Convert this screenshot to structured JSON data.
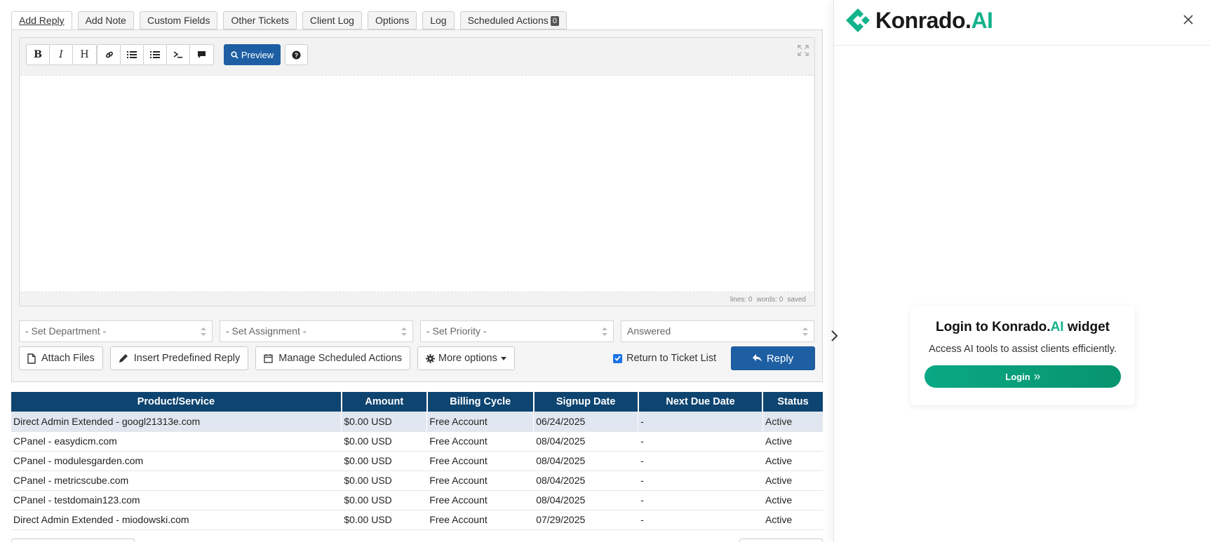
{
  "tabs": [
    {
      "label": "Add Reply",
      "active": true
    },
    {
      "label": "Add Note"
    },
    {
      "label": "Custom Fields"
    },
    {
      "label": "Other Tickets"
    },
    {
      "label": "Client Log"
    },
    {
      "label": "Options"
    },
    {
      "label": "Log"
    },
    {
      "label": "Scheduled Actions",
      "badge": "0"
    }
  ],
  "editor": {
    "toolbar": {
      "bold": "B",
      "italic": "I",
      "heading": "H",
      "preview_label": "Preview"
    },
    "status": {
      "lines": "lines: 0",
      "words": "words: 0",
      "saved": "saved"
    }
  },
  "selects": {
    "department": "- Set Department -",
    "assignment": "- Set Assignment -",
    "priority": "- Set Priority -",
    "status": "Answered"
  },
  "actions": {
    "attach": "Attach Files",
    "predefined": "Insert Predefined Reply",
    "scheduled": "Manage Scheduled Actions",
    "more": "More options",
    "return_label": "Return to Ticket List",
    "return_checked": true,
    "reply": "Reply"
  },
  "table": {
    "headers": [
      "Product/Service",
      "Amount",
      "Billing Cycle",
      "Signup Date",
      "Next Due Date",
      "Status"
    ],
    "rows": [
      [
        "Direct Admin Extended - googl21313e.com",
        "$0.00 USD",
        "Free Account",
        "06/24/2025",
        "-",
        "Active"
      ],
      [
        "CPanel - easydicm.com",
        "$0.00 USD",
        "Free Account",
        "08/04/2025",
        "-",
        "Active"
      ],
      [
        "CPanel - modulesgarden.com",
        "$0.00 USD",
        "Free Account",
        "08/04/2025",
        "-",
        "Active"
      ],
      [
        "CPanel - metricscube.com",
        "$0.00 USD",
        "Free Account",
        "08/04/2025",
        "-",
        "Active"
      ],
      [
        "CPanel - testdomain123.com",
        "$0.00 USD",
        "Free Account",
        "08/04/2025",
        "-",
        "Active"
      ],
      [
        "Direct Admin Extended - miodowski.com",
        "$0.00 USD",
        "Free Account",
        "07/29/2025",
        "-",
        "Active"
      ]
    ]
  },
  "widget": {
    "brand": "Konrado.",
    "brand_ai": "AI",
    "card_title_prefix": "Login to Konrado.",
    "card_title_ai": "AI",
    "card_title_suffix": " widget",
    "card_text": "Access AI tools to assist clients efficiently.",
    "login_label": "Login",
    "accent": "#13b38c"
  },
  "colors": {
    "primary": "#1e5fa4",
    "table_header": "#0e4470"
  }
}
